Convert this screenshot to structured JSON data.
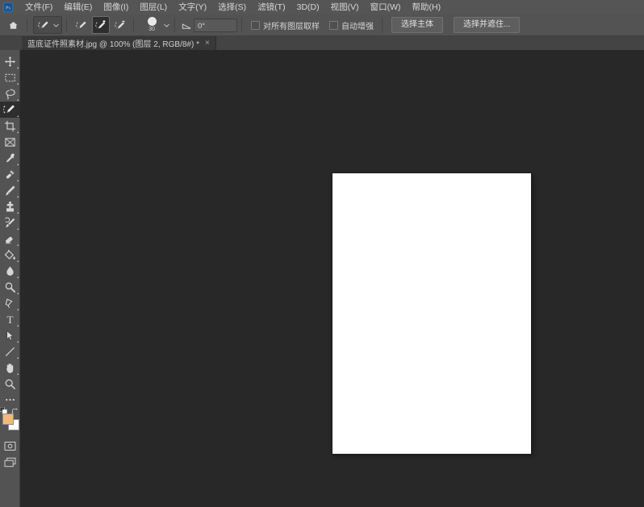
{
  "app": {
    "name": "Adobe Photoshop",
    "logo_text": "Ps"
  },
  "menubar": {
    "items": [
      {
        "label": "文件(F)",
        "name": "menu-file"
      },
      {
        "label": "编辑(E)",
        "name": "menu-edit"
      },
      {
        "label": "图像(I)",
        "name": "menu-image"
      },
      {
        "label": "图层(L)",
        "name": "menu-layer"
      },
      {
        "label": "文字(Y)",
        "name": "menu-type"
      },
      {
        "label": "选择(S)",
        "name": "menu-select"
      },
      {
        "label": "滤镜(T)",
        "name": "menu-filter"
      },
      {
        "label": "3D(D)",
        "name": "menu-3d"
      },
      {
        "label": "视图(V)",
        "name": "menu-view"
      },
      {
        "label": "窗口(W)",
        "name": "menu-window"
      },
      {
        "label": "帮助(H)",
        "name": "menu-help"
      }
    ]
  },
  "optionsbar": {
    "home_icon": "home-icon",
    "tool_preset_icon": "quick-selection-tool-icon",
    "selection_modes": [
      {
        "name": "new-selection-mode",
        "icon": "quick-selection-new-icon",
        "active": false
      },
      {
        "name": "add-to-selection-mode",
        "icon": "quick-selection-add-icon",
        "active": true
      },
      {
        "name": "subtract-from-selection-mode",
        "icon": "quick-selection-subtract-icon",
        "active": false
      }
    ],
    "brush_size": "30",
    "angle_value": "0°",
    "angle_icon": "angle-icon",
    "checkboxes": [
      {
        "label": "对所有图层取样",
        "name": "sample-all-layers-checkbox",
        "checked": false
      },
      {
        "label": "自动增强",
        "name": "auto-enhance-checkbox",
        "checked": false
      }
    ],
    "buttons": [
      {
        "label": "选择主体",
        "name": "select-subject-button"
      },
      {
        "label": "选择并遮住...",
        "name": "select-and-mask-button"
      }
    ]
  },
  "tabbar": {
    "document_tab": {
      "title": "蓝底证件照素材.jpg @ 100% (图层 2, RGB/8#) *",
      "close_glyph": "×"
    }
  },
  "toolbar": {
    "tools": [
      {
        "name": "move-tool",
        "icon": "move-icon",
        "has_flyout": true,
        "active": false
      },
      {
        "name": "rectangular-marquee-tool",
        "icon": "marquee-icon",
        "has_flyout": true,
        "active": false
      },
      {
        "name": "lasso-tool",
        "icon": "lasso-icon",
        "has_flyout": true,
        "active": false
      },
      {
        "name": "quick-selection-tool",
        "icon": "quick-selection-icon",
        "has_flyout": true,
        "active": true
      },
      {
        "name": "crop-tool",
        "icon": "crop-icon",
        "has_flyout": true,
        "active": false
      },
      {
        "name": "frame-tool",
        "icon": "frame-icon",
        "has_flyout": false,
        "active": false
      },
      {
        "name": "eyedropper-tool",
        "icon": "eyedropper-icon",
        "has_flyout": true,
        "active": false
      },
      {
        "name": "spot-healing-brush-tool",
        "icon": "healing-brush-icon",
        "has_flyout": true,
        "active": false
      },
      {
        "name": "brush-tool",
        "icon": "brush-icon",
        "has_flyout": true,
        "active": false
      },
      {
        "name": "clone-stamp-tool",
        "icon": "clone-stamp-icon",
        "has_flyout": true,
        "active": false
      },
      {
        "name": "history-brush-tool",
        "icon": "history-brush-icon",
        "has_flyout": true,
        "active": false
      },
      {
        "name": "eraser-tool",
        "icon": "eraser-icon",
        "has_flyout": true,
        "active": false
      },
      {
        "name": "gradient-tool",
        "icon": "paint-bucket-icon",
        "has_flyout": true,
        "active": false
      },
      {
        "name": "blur-tool",
        "icon": "blur-droplet-icon",
        "has_flyout": true,
        "active": false
      },
      {
        "name": "dodge-tool",
        "icon": "dodge-icon",
        "has_flyout": true,
        "active": false
      },
      {
        "name": "pen-tool",
        "icon": "pen-icon",
        "has_flyout": true,
        "active": false
      },
      {
        "name": "type-tool",
        "icon": "type-t-icon",
        "has_flyout": true,
        "active": false
      },
      {
        "name": "path-selection-tool",
        "icon": "path-arrow-icon",
        "has_flyout": true,
        "active": false
      },
      {
        "name": "line-tool",
        "icon": "line-shape-icon",
        "has_flyout": true,
        "active": false
      },
      {
        "name": "hand-tool",
        "icon": "hand-icon",
        "has_flyout": true,
        "active": false
      },
      {
        "name": "zoom-tool",
        "icon": "magnifier-icon",
        "has_flyout": false,
        "active": false
      },
      {
        "name": "edit-toolbar-button",
        "icon": "ellipsis-icon",
        "has_flyout": false,
        "active": false
      }
    ],
    "colors": {
      "foreground": "#f5b87c",
      "background": "#ffffff",
      "swap_icon": "swap-colors-icon",
      "default_icon": "default-colors-icon"
    },
    "bottom_tools": [
      {
        "name": "quick-mask-toggle",
        "icon": "quick-mask-icon"
      },
      {
        "name": "screen-mode-toggle",
        "icon": "screen-mode-icon"
      }
    ]
  },
  "canvas": {
    "background_color": "#282828",
    "document_color": "#ffffff",
    "zoom_level": "100%"
  }
}
